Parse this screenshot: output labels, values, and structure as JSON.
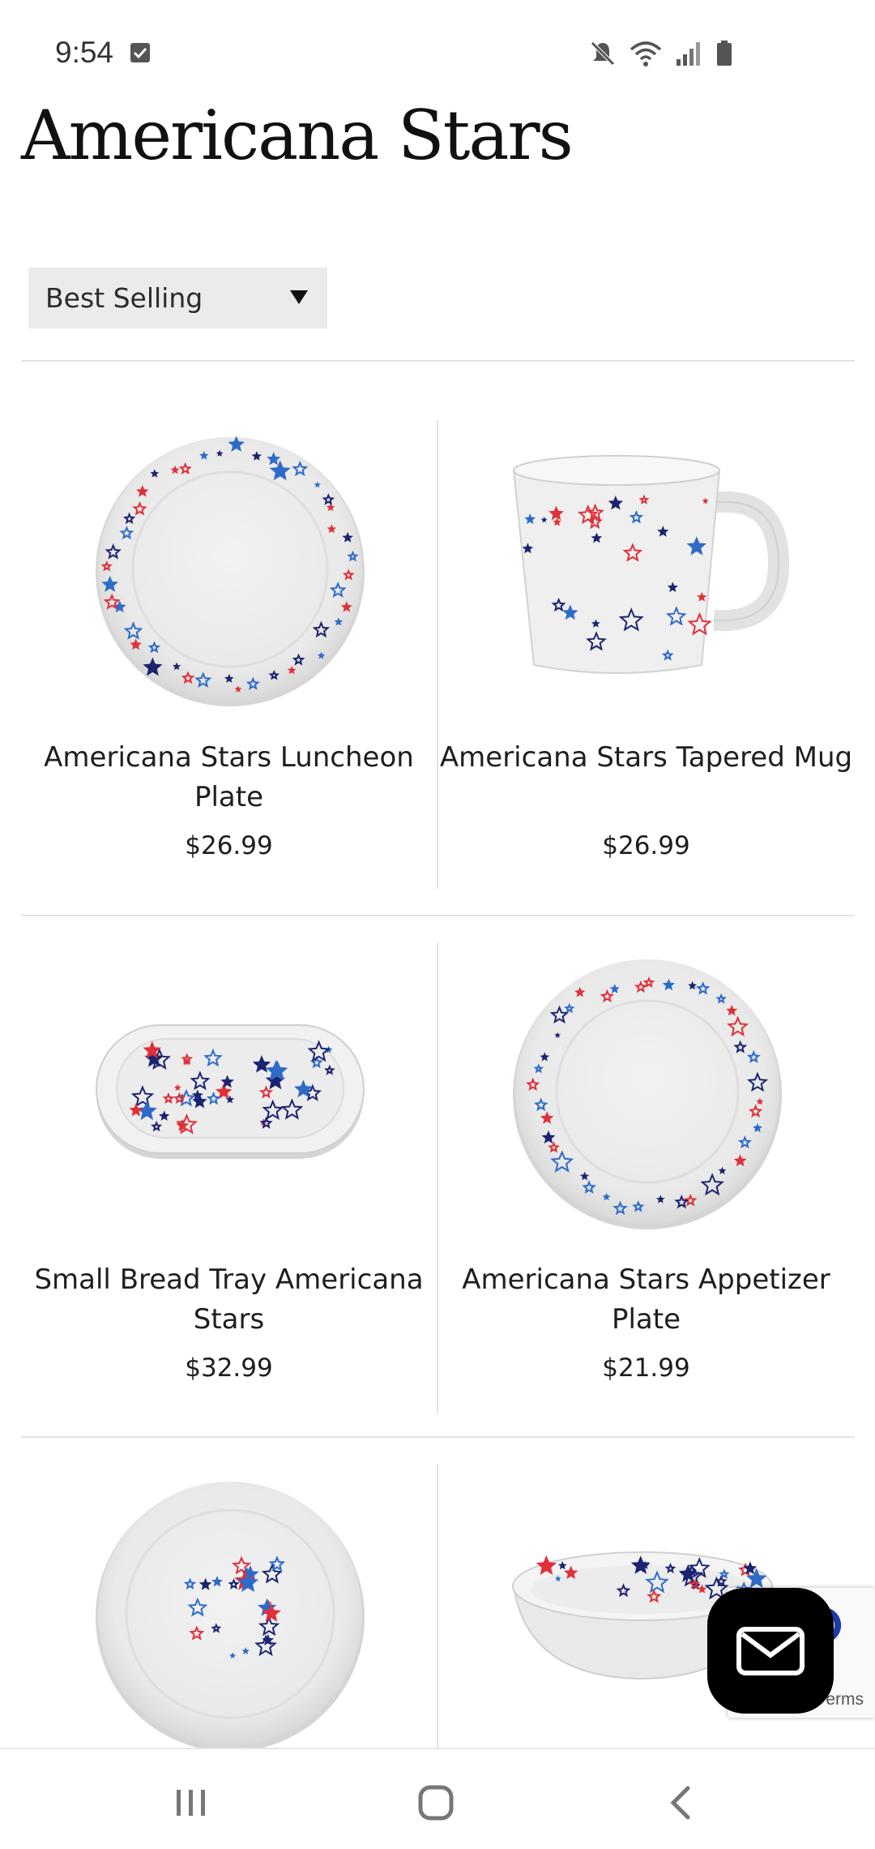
{
  "status_bar": {
    "time": "9:54",
    "icons": [
      "checkbox-notification-icon",
      "mute-icon",
      "wifi-icon",
      "signal-icon",
      "battery-icon"
    ]
  },
  "page": {
    "title": "Americana Stars"
  },
  "sort": {
    "selected": "Best Selling"
  },
  "products": [
    {
      "name": "Americana Stars Luncheon Plate",
      "price": "$26.99",
      "image": "luncheon-plate-image"
    },
    {
      "name": "Americana Stars Tapered Mug",
      "price": "$26.99",
      "image": "tapered-mug-image"
    },
    {
      "name": "Small Bread Tray Americana Stars",
      "price": "$32.99",
      "image": "bread-tray-image"
    },
    {
      "name": "Americana Stars Appetizer Plate",
      "price": "$21.99",
      "image": "appetizer-plate-image"
    },
    {
      "name": "",
      "price": "",
      "image": "dinner-plate-image"
    },
    {
      "name": "",
      "price": "",
      "image": "bowl-image"
    }
  ],
  "recaptcha": {
    "text": "erms"
  },
  "colors": {
    "star_red": "#e0303a",
    "star_blue": "#2e6bc9",
    "star_navy": "#1b2470",
    "ceramic": "#f3f3f3"
  },
  "nav_bar": {
    "buttons": [
      "recent-apps-button",
      "home-button",
      "back-button"
    ]
  }
}
